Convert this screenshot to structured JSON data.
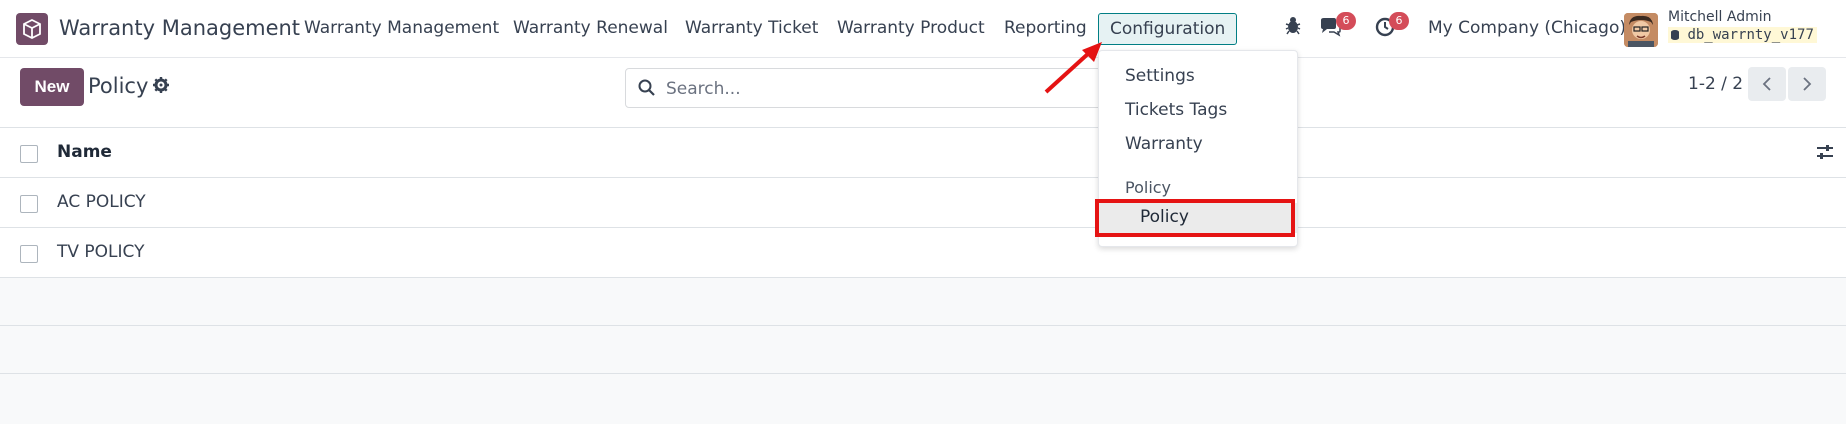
{
  "app": {
    "title": "Warranty Management",
    "icon": "box-icon",
    "brand_color": "#714b67"
  },
  "nav": {
    "items": [
      {
        "label": "Warranty Management"
      },
      {
        "label": "Warranty Renewal"
      },
      {
        "label": "Warranty Ticket"
      },
      {
        "label": "Warranty Product"
      },
      {
        "label": "Reporting"
      },
      {
        "label": "Configuration"
      }
    ]
  },
  "systray": {
    "debug_icon": "bug-icon",
    "messages": {
      "icon": "chat-icon",
      "count": "6"
    },
    "activities": {
      "icon": "clock-icon",
      "count": "6"
    },
    "company": "My Company (Chicago)",
    "user": {
      "name": "Mitchell Admin",
      "db": "db_warrnty_v177"
    }
  },
  "control": {
    "new_label": "New",
    "breadcrumb": "Policy",
    "search_placeholder": "Search...",
    "pager": "1-2 / 2"
  },
  "table": {
    "columns": [
      "Name"
    ],
    "rows": [
      {
        "name": "AC POLICY"
      },
      {
        "name": "TV POLICY"
      }
    ]
  },
  "dropdown": {
    "items": [
      "Settings",
      "Tickets Tags",
      "Warranty"
    ],
    "section": "Policy",
    "sub_item": "Policy"
  },
  "colors": {
    "accent": "#017e84",
    "highlight": "#e51313",
    "badge": "#d44c59"
  }
}
